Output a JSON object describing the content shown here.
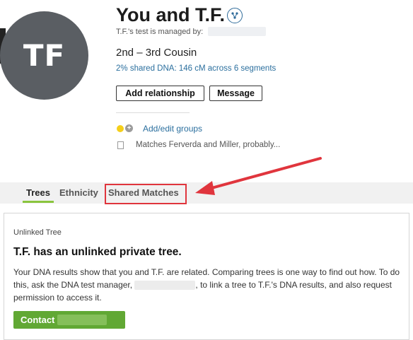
{
  "profile": {
    "initials": "TF",
    "title": "You and T.F.",
    "managed_by": "T.F.'s test is managed by:",
    "relationship": "2nd – 3rd Cousin",
    "shared_dna": "2% shared DNA: 146 cM across 6 segments"
  },
  "actions": {
    "add_relationship": "Add relationship",
    "message": "Message"
  },
  "groups": {
    "link": "Add/edit groups",
    "group_color": "#f5cf1a"
  },
  "note": {
    "text": "Matches Ferverda and Miller, probably..."
  },
  "tabs": [
    {
      "label": "Trees",
      "active": true
    },
    {
      "label": "Ethnicity",
      "active": false
    },
    {
      "label": "Shared Matches",
      "active": false,
      "highlighted": true
    }
  ],
  "tree_card": {
    "label": "Unlinked Tree",
    "heading": "T.F. has an unlinked private tree.",
    "body_part1": "Your DNA results show that you and T.F. are related. Comparing trees is one way to find out how. To do this, ask the DNA test manager, ",
    "body_part2": ", to link a tree to T.F.'s DNA results, and also request permission to access it.",
    "contact_label": "Contact"
  },
  "colors": {
    "accent_link": "#2b6f9e",
    "active_tab_underline": "#8ac53e",
    "contact_button": "#61a834",
    "annotation_red": "#e0353d"
  },
  "icons": {
    "dna_badge": "dna-icon",
    "add_group": "plus-circle-icon",
    "note": "note-icon",
    "annotation": "red-arrow-icon"
  }
}
